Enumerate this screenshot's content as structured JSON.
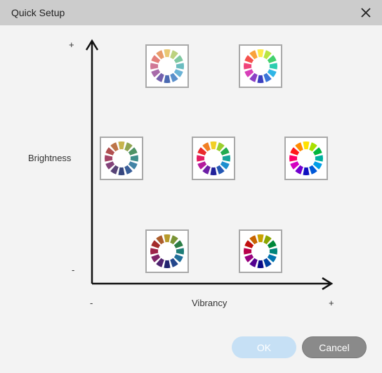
{
  "window": {
    "title": "Quick Setup",
    "close_icon": "close-icon"
  },
  "axes": {
    "y_label": "Brightness",
    "y_plus": "+",
    "y_minus": "-",
    "x_label": "Vibrancy",
    "x_minus": "-",
    "x_plus": "+"
  },
  "presets": [
    {
      "id": "preset-bright-low-vibrancy",
      "brightness": "high",
      "vibrancy": "low-mid",
      "icon": "color-wheel-icon",
      "colors": [
        "#e9c874",
        "#bcd27f",
        "#7fc8a1",
        "#6bbcc0",
        "#6ab3d6",
        "#5a8fcb",
        "#4b6ab2",
        "#7360ad",
        "#a86aaa",
        "#d07896",
        "#e37f7a",
        "#e89b6b"
      ]
    },
    {
      "id": "preset-bright-high-vibrancy",
      "brightness": "high",
      "vibrancy": "mid-high",
      "icon": "color-wheel-icon",
      "colors": [
        "#fde94a",
        "#b8e542",
        "#42d16d",
        "#2ccdb0",
        "#2fb5e6",
        "#3a74d8",
        "#3b3fbf",
        "#8b3fc6",
        "#d73fb9",
        "#f0437a",
        "#f5514d",
        "#f9a23b"
      ]
    },
    {
      "id": "preset-mid-low-vibrancy",
      "brightness": "mid",
      "vibrancy": "low",
      "icon": "color-wheel-icon",
      "colors": [
        "#c7b44d",
        "#8fa451",
        "#4f9466",
        "#3f8f8a",
        "#4384a6",
        "#395e98",
        "#36467f",
        "#574377",
        "#83437a",
        "#a44466",
        "#b04f4f",
        "#bd7448"
      ]
    },
    {
      "id": "preset-mid-mid-vibrancy",
      "brightness": "mid",
      "vibrancy": "mid",
      "icon": "color-wheel-icon",
      "colors": [
        "#f2cf26",
        "#9ccf2e",
        "#22ab50",
        "#16a39a",
        "#1d8fcf",
        "#2457b4",
        "#22219a",
        "#6d1fa6",
        "#b51b9d",
        "#e41c5f",
        "#ea2a2a",
        "#f17f23"
      ]
    },
    {
      "id": "preset-mid-high-vibrancy",
      "brightness": "mid",
      "vibrancy": "high",
      "icon": "color-wheel-icon",
      "colors": [
        "#ffe100",
        "#a8e000",
        "#00b63c",
        "#00b0a0",
        "#009ee8",
        "#0058d8",
        "#1010c0",
        "#7200d0",
        "#d400c0",
        "#ff0066",
        "#ff1a1a",
        "#ff8c00"
      ]
    },
    {
      "id": "preset-dark-low-vibrancy",
      "brightness": "low",
      "vibrancy": "low-mid",
      "icon": "color-wheel-icon",
      "colors": [
        "#b79b2b",
        "#7a9436",
        "#2b7d45",
        "#1f7d77",
        "#216f9b",
        "#23468b",
        "#22246f",
        "#4f236f",
        "#7f2468",
        "#9d2349",
        "#a32b2b",
        "#ad5d2c"
      ]
    },
    {
      "id": "preset-dark-high-vibrancy",
      "brightness": "low",
      "vibrancy": "mid-high",
      "icon": "color-wheel-icon",
      "colors": [
        "#c9a200",
        "#8aa600",
        "#00883a",
        "#00847a",
        "#0074b0",
        "#003fa0",
        "#0c0c88",
        "#52008f",
        "#98007f",
        "#b8004a",
        "#c00f0f",
        "#c86400"
      ]
    }
  ],
  "buttons": {
    "ok_label": "OK",
    "cancel_label": "Cancel"
  }
}
